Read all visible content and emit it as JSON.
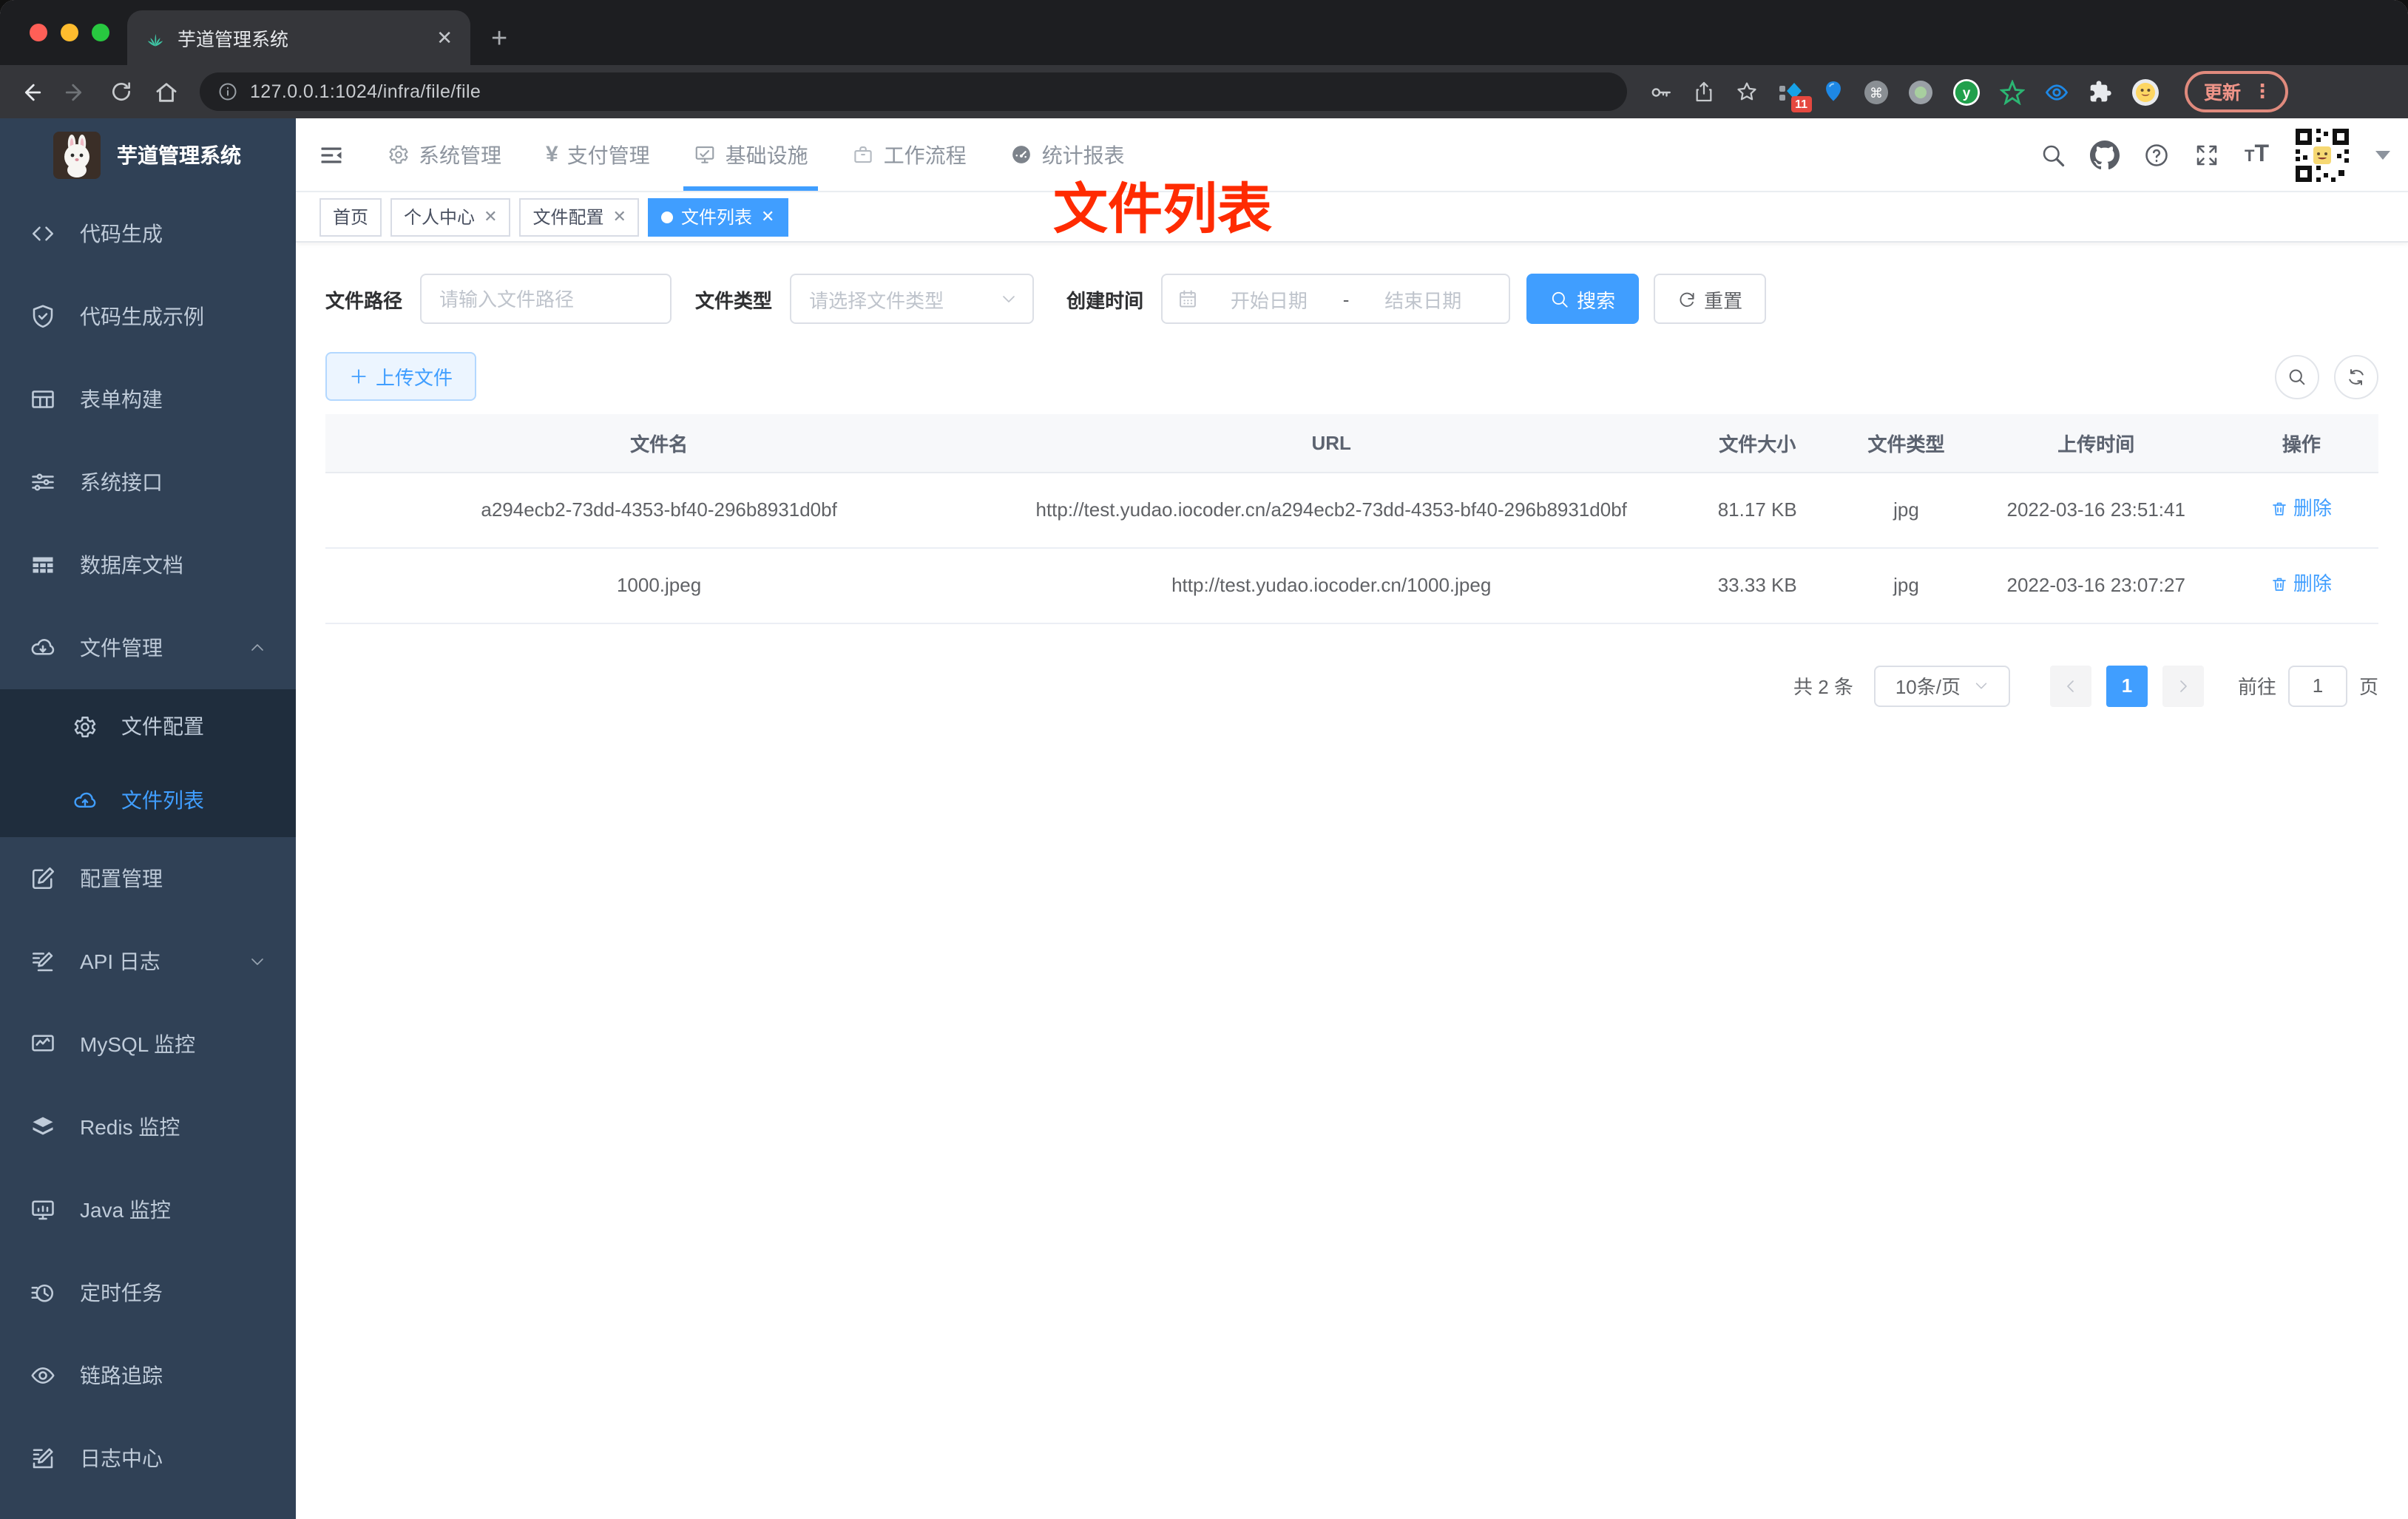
{
  "browser": {
    "tab_title": "芋道管理系统",
    "url": "127.0.0.1:1024/infra/file/file",
    "extensions_badge": "11",
    "update_label": "更新",
    "ext_y_letter": "y"
  },
  "sidebar": {
    "logo_title": "芋道管理系统",
    "items": [
      {
        "label": "代码生成",
        "icon": "code-icon"
      },
      {
        "label": "代码生成示例",
        "icon": "shield-check-icon"
      },
      {
        "label": "表单构建",
        "icon": "form-grid-icon"
      },
      {
        "label": "系统接口",
        "icon": "sliders-icon"
      },
      {
        "label": "数据库文档",
        "icon": "table-icon"
      },
      {
        "label": "文件管理",
        "icon": "cloud-download-icon",
        "expanded": true,
        "children": [
          {
            "label": "文件配置",
            "icon": "gear-icon"
          },
          {
            "label": "文件列表",
            "icon": "cloud-upload-icon",
            "active": true
          }
        ]
      },
      {
        "label": "配置管理",
        "icon": "edit-square-icon"
      },
      {
        "label": "API 日志",
        "icon": "document-edit-icon",
        "collapsed": true
      },
      {
        "label": "MySQL 监控",
        "icon": "chart-monitor-icon"
      },
      {
        "label": "Redis 监控",
        "icon": "layers-icon"
      },
      {
        "label": "Java 监控",
        "icon": "monitor-icon"
      },
      {
        "label": "定时任务",
        "icon": "timer-icon"
      },
      {
        "label": "链路追踪",
        "icon": "eye-icon"
      },
      {
        "label": "日志中心",
        "icon": "log-edit-icon"
      }
    ]
  },
  "topnav": {
    "items": [
      {
        "label": "系统管理",
        "icon": "gear-icon"
      },
      {
        "label": "支付管理",
        "icon": "yen-icon",
        "yen": "¥"
      },
      {
        "label": "基础设施",
        "icon": "monitor-check-icon",
        "active": true
      },
      {
        "label": "工作流程",
        "icon": "briefcase-icon"
      },
      {
        "label": "统计报表",
        "icon": "gauge-icon"
      }
    ]
  },
  "tags": {
    "items": [
      {
        "label": "首页",
        "closable": false
      },
      {
        "label": "个人中心",
        "closable": true
      },
      {
        "label": "文件配置",
        "closable": true
      },
      {
        "label": "文件列表",
        "closable": true,
        "active": true
      }
    ]
  },
  "annotation": {
    "text": "文件列表"
  },
  "filters": {
    "path_label": "文件路径",
    "path_placeholder": "请输入文件路径",
    "type_label": "文件类型",
    "type_placeholder": "请选择文件类型",
    "date_label": "创建时间",
    "date_start_placeholder": "开始日期",
    "date_separator": "-",
    "date_end_placeholder": "结束日期",
    "search_label": "搜索",
    "reset_label": "重置"
  },
  "toolbar": {
    "upload_label": "上传文件"
  },
  "table": {
    "columns": [
      "文件名",
      "URL",
      "文件大小",
      "文件类型",
      "上传时间",
      "操作"
    ],
    "delete_label": "删除",
    "rows": [
      {
        "name": "a294ecb2-73dd-4353-bf40-296b8931d0bf",
        "url": "http://test.yudao.iocoder.cn/a294ecb2-73dd-4353-bf40-296b8931d0bf",
        "size": "81.17 KB",
        "type": "jpg",
        "time": "2022-03-16 23:51:41"
      },
      {
        "name": "1000.jpeg",
        "url": "http://test.yudao.iocoder.cn/1000.jpeg",
        "size": "33.33 KB",
        "type": "jpg",
        "time": "2022-03-16 23:07:27"
      }
    ]
  },
  "pagination": {
    "total_text": "共 2 条",
    "page_size_text": "10条/页",
    "current_page": "1",
    "goto_label": "前往",
    "goto_value": "1",
    "unit_label": "页"
  },
  "colors": {
    "accent": "#409eff",
    "sidebar_bg": "#304156",
    "submenu_bg": "#1f2d3d",
    "annotation_red": "#ff2b01",
    "tag_active_bg": "#409eff",
    "update_button_red": "#ef9488"
  }
}
